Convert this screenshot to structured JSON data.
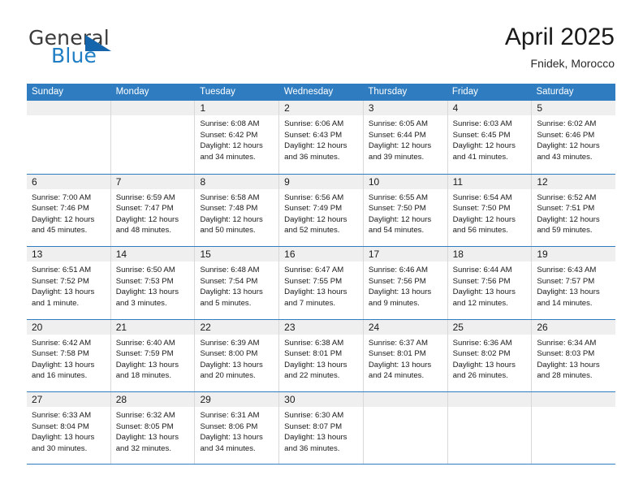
{
  "brand": {
    "name_top": "General",
    "name_bottom": "Blue"
  },
  "header": {
    "title": "April 2025",
    "subtitle": "Fnidek, Morocco"
  },
  "colors": {
    "header_blue": "#2f7dc0",
    "brand_blue": "#1f7ec4",
    "triangle_blue": "#1565ad",
    "daynum_band": "#efefef",
    "cell_divider": "#d8d8d8"
  },
  "weekdays": [
    "Sunday",
    "Monday",
    "Tuesday",
    "Wednesday",
    "Thursday",
    "Friday",
    "Saturday"
  ],
  "weeks": [
    [
      {
        "day": "",
        "lines": []
      },
      {
        "day": "",
        "lines": []
      },
      {
        "day": "1",
        "lines": [
          "Sunrise: 6:08 AM",
          "Sunset: 6:42 PM",
          "Daylight: 12 hours",
          "and 34 minutes."
        ]
      },
      {
        "day": "2",
        "lines": [
          "Sunrise: 6:06 AM",
          "Sunset: 6:43 PM",
          "Daylight: 12 hours",
          "and 36 minutes."
        ]
      },
      {
        "day": "3",
        "lines": [
          "Sunrise: 6:05 AM",
          "Sunset: 6:44 PM",
          "Daylight: 12 hours",
          "and 39 minutes."
        ]
      },
      {
        "day": "4",
        "lines": [
          "Sunrise: 6:03 AM",
          "Sunset: 6:45 PM",
          "Daylight: 12 hours",
          "and 41 minutes."
        ]
      },
      {
        "day": "5",
        "lines": [
          "Sunrise: 6:02 AM",
          "Sunset: 6:46 PM",
          "Daylight: 12 hours",
          "and 43 minutes."
        ]
      }
    ],
    [
      {
        "day": "6",
        "lines": [
          "Sunrise: 7:00 AM",
          "Sunset: 7:46 PM",
          "Daylight: 12 hours",
          "and 45 minutes."
        ]
      },
      {
        "day": "7",
        "lines": [
          "Sunrise: 6:59 AM",
          "Sunset: 7:47 PM",
          "Daylight: 12 hours",
          "and 48 minutes."
        ]
      },
      {
        "day": "8",
        "lines": [
          "Sunrise: 6:58 AM",
          "Sunset: 7:48 PM",
          "Daylight: 12 hours",
          "and 50 minutes."
        ]
      },
      {
        "day": "9",
        "lines": [
          "Sunrise: 6:56 AM",
          "Sunset: 7:49 PM",
          "Daylight: 12 hours",
          "and 52 minutes."
        ]
      },
      {
        "day": "10",
        "lines": [
          "Sunrise: 6:55 AM",
          "Sunset: 7:50 PM",
          "Daylight: 12 hours",
          "and 54 minutes."
        ]
      },
      {
        "day": "11",
        "lines": [
          "Sunrise: 6:54 AM",
          "Sunset: 7:50 PM",
          "Daylight: 12 hours",
          "and 56 minutes."
        ]
      },
      {
        "day": "12",
        "lines": [
          "Sunrise: 6:52 AM",
          "Sunset: 7:51 PM",
          "Daylight: 12 hours",
          "and 59 minutes."
        ]
      }
    ],
    [
      {
        "day": "13",
        "lines": [
          "Sunrise: 6:51 AM",
          "Sunset: 7:52 PM",
          "Daylight: 13 hours",
          "and 1 minute."
        ]
      },
      {
        "day": "14",
        "lines": [
          "Sunrise: 6:50 AM",
          "Sunset: 7:53 PM",
          "Daylight: 13 hours",
          "and 3 minutes."
        ]
      },
      {
        "day": "15",
        "lines": [
          "Sunrise: 6:48 AM",
          "Sunset: 7:54 PM",
          "Daylight: 13 hours",
          "and 5 minutes."
        ]
      },
      {
        "day": "16",
        "lines": [
          "Sunrise: 6:47 AM",
          "Sunset: 7:55 PM",
          "Daylight: 13 hours",
          "and 7 minutes."
        ]
      },
      {
        "day": "17",
        "lines": [
          "Sunrise: 6:46 AM",
          "Sunset: 7:56 PM",
          "Daylight: 13 hours",
          "and 9 minutes."
        ]
      },
      {
        "day": "18",
        "lines": [
          "Sunrise: 6:44 AM",
          "Sunset: 7:56 PM",
          "Daylight: 13 hours",
          "and 12 minutes."
        ]
      },
      {
        "day": "19",
        "lines": [
          "Sunrise: 6:43 AM",
          "Sunset: 7:57 PM",
          "Daylight: 13 hours",
          "and 14 minutes."
        ]
      }
    ],
    [
      {
        "day": "20",
        "lines": [
          "Sunrise: 6:42 AM",
          "Sunset: 7:58 PM",
          "Daylight: 13 hours",
          "and 16 minutes."
        ]
      },
      {
        "day": "21",
        "lines": [
          "Sunrise: 6:40 AM",
          "Sunset: 7:59 PM",
          "Daylight: 13 hours",
          "and 18 minutes."
        ]
      },
      {
        "day": "22",
        "lines": [
          "Sunrise: 6:39 AM",
          "Sunset: 8:00 PM",
          "Daylight: 13 hours",
          "and 20 minutes."
        ]
      },
      {
        "day": "23",
        "lines": [
          "Sunrise: 6:38 AM",
          "Sunset: 8:01 PM",
          "Daylight: 13 hours",
          "and 22 minutes."
        ]
      },
      {
        "day": "24",
        "lines": [
          "Sunrise: 6:37 AM",
          "Sunset: 8:01 PM",
          "Daylight: 13 hours",
          "and 24 minutes."
        ]
      },
      {
        "day": "25",
        "lines": [
          "Sunrise: 6:36 AM",
          "Sunset: 8:02 PM",
          "Daylight: 13 hours",
          "and 26 minutes."
        ]
      },
      {
        "day": "26",
        "lines": [
          "Sunrise: 6:34 AM",
          "Sunset: 8:03 PM",
          "Daylight: 13 hours",
          "and 28 minutes."
        ]
      }
    ],
    [
      {
        "day": "27",
        "lines": [
          "Sunrise: 6:33 AM",
          "Sunset: 8:04 PM",
          "Daylight: 13 hours",
          "and 30 minutes."
        ]
      },
      {
        "day": "28",
        "lines": [
          "Sunrise: 6:32 AM",
          "Sunset: 8:05 PM",
          "Daylight: 13 hours",
          "and 32 minutes."
        ]
      },
      {
        "day": "29",
        "lines": [
          "Sunrise: 6:31 AM",
          "Sunset: 8:06 PM",
          "Daylight: 13 hours",
          "and 34 minutes."
        ]
      },
      {
        "day": "30",
        "lines": [
          "Sunrise: 6:30 AM",
          "Sunset: 8:07 PM",
          "Daylight: 13 hours",
          "and 36 minutes."
        ]
      },
      {
        "day": "",
        "lines": []
      },
      {
        "day": "",
        "lines": []
      },
      {
        "day": "",
        "lines": []
      }
    ]
  ]
}
